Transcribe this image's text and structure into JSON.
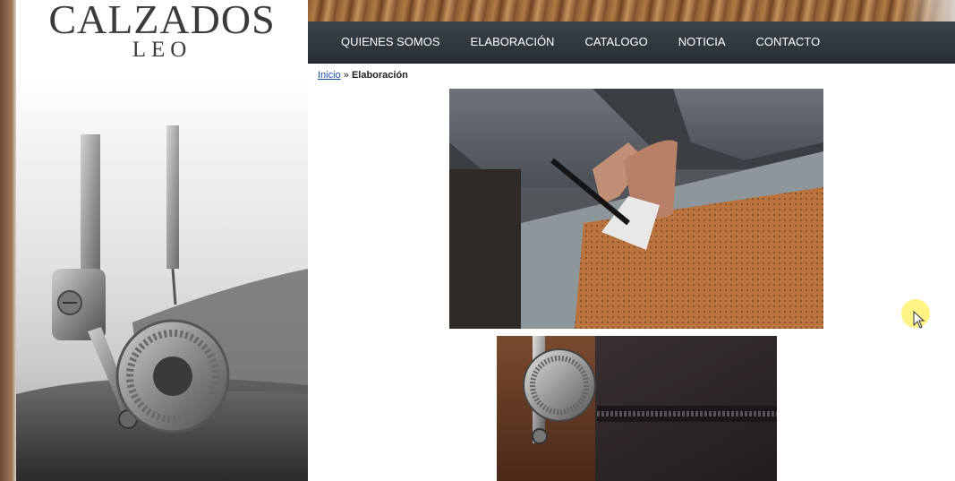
{
  "brand": {
    "name_top": "CALZADOS",
    "name_bottom": "LEO"
  },
  "nav": {
    "items": [
      {
        "label": "QUIENES SOMOS"
      },
      {
        "label": "ELABORACIÓN"
      },
      {
        "label": "CATALOGO"
      },
      {
        "label": "NOTICIA"
      },
      {
        "label": "CONTACTO"
      }
    ]
  },
  "breadcrumb": {
    "home": "Inicio",
    "separator": "»",
    "current": "Elaboración"
  },
  "colors": {
    "nav_background": "#2f353b",
    "nav_text": "#ffffff",
    "link": "#1a4fa8",
    "leather": "#a8683a"
  },
  "icons": {
    "cursor": "mouse-pointer-icon",
    "cursor_highlight": "cursor-highlight"
  }
}
